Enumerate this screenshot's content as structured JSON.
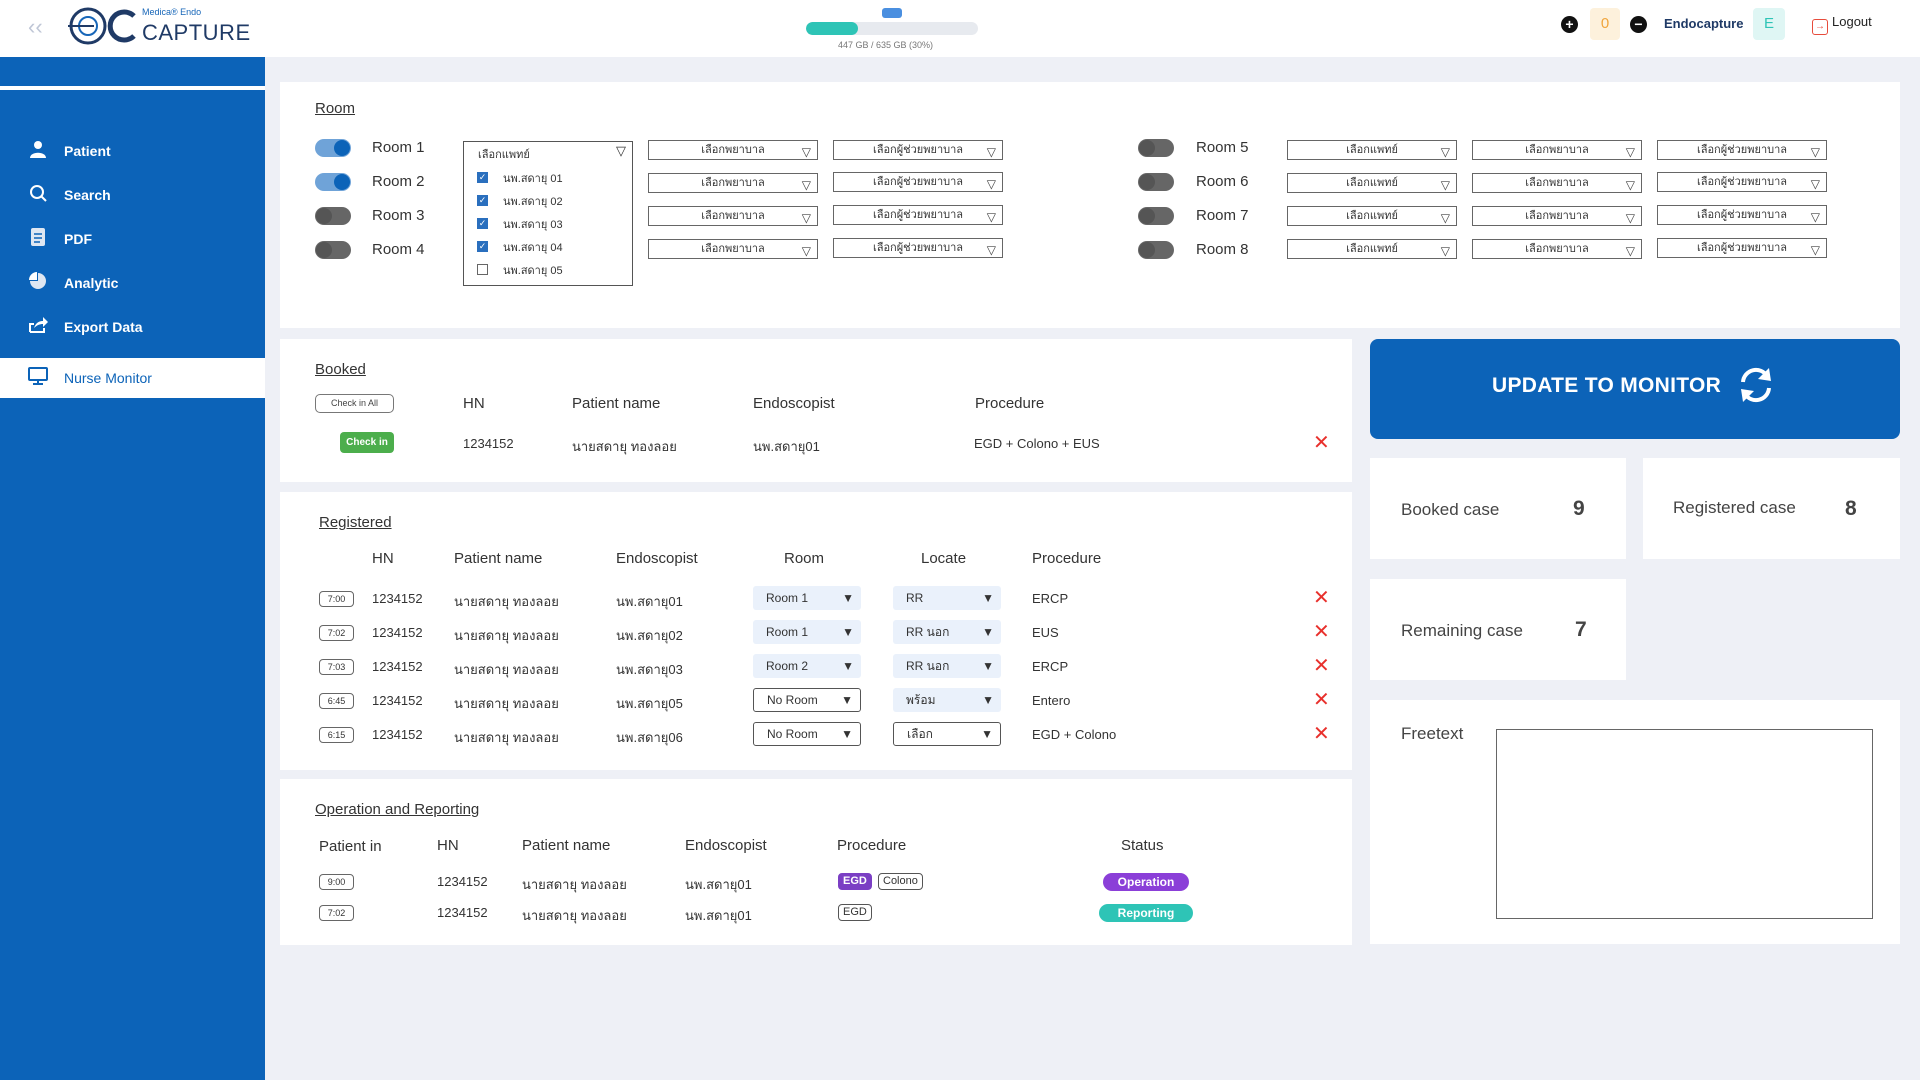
{
  "header": {
    "logo_small": "Medica® Endo",
    "logo_big": "CAPTURE",
    "storage_text": "447 GB / 635 GB    (30%)",
    "storage_percent": 30,
    "counter": "0",
    "user_name": "Endocapture",
    "avatar_letter": "E",
    "logout_label": "Logout"
  },
  "sidebar": {
    "items": [
      {
        "label": "Patient",
        "icon": "person-icon"
      },
      {
        "label": "Search",
        "icon": "search-icon"
      },
      {
        "label": "PDF",
        "icon": "pdf-icon"
      },
      {
        "label": "Analytic",
        "icon": "chart-icon"
      },
      {
        "label": "Export Data",
        "icon": "share-icon"
      },
      {
        "label": "Nurse Monitor",
        "icon": "monitor-icon"
      }
    ]
  },
  "room_section": {
    "title": "Room",
    "rooms": [
      {
        "label": "Room 1",
        "on": true
      },
      {
        "label": "Room 2",
        "on": true
      },
      {
        "label": "Room 3",
        "on": false
      },
      {
        "label": "Room 4",
        "on": false
      },
      {
        "label": "Room 5",
        "on": false
      },
      {
        "label": "Room 6",
        "on": false
      },
      {
        "label": "Room 7",
        "on": false
      },
      {
        "label": "Room 8",
        "on": false
      }
    ],
    "doctor_placeholder": "เลือกแพทย์",
    "nurse_placeholder": "เลือกพยาบาล",
    "assistant_placeholder": "เลือกผู้ช่วยพยาบาล",
    "doctor_options": [
      {
        "label": "นพ.สดายุ 01",
        "checked": true
      },
      {
        "label": "นพ.สดายุ 02",
        "checked": true
      },
      {
        "label": "นพ.สดายุ 03",
        "checked": true
      },
      {
        "label": "นพ.สดายุ 04",
        "checked": true
      },
      {
        "label": "นพ.สดายุ 05",
        "checked": false
      }
    ]
  },
  "booked": {
    "title": "Booked",
    "check_in_all": "Check in All",
    "headers": {
      "hn": "HN",
      "name": "Patient name",
      "endoscopist": "Endoscopist",
      "procedure": "Procedure"
    },
    "row": {
      "action": "Check in",
      "hn": "1234152",
      "name": "นายสดายุ ทองลอย",
      "endoscopist": "นพ.สดายุ01",
      "procedure": "EGD + Colono + EUS"
    }
  },
  "registered": {
    "title": "Registered",
    "headers": {
      "hn": "HN",
      "name": "Patient name",
      "endoscopist": "Endoscopist",
      "room": "Room",
      "locate": "Locate",
      "procedure": "Procedure"
    },
    "rows": [
      {
        "time": "7:00",
        "hn": "1234152",
        "name": "นายสดายุ ทองลอย",
        "endoscopist": "นพ.สดายุ01",
        "room": "Room 1",
        "locate": "RR",
        "procedure": "ERCP"
      },
      {
        "time": "7:02",
        "hn": "1234152",
        "name": "นายสดายุ ทองลอย",
        "endoscopist": "นพ.สดายุ02",
        "room": "Room 1",
        "locate": "RR นอก",
        "procedure": "EUS"
      },
      {
        "time": "7:03",
        "hn": "1234152",
        "name": "นายสดายุ ทองลอย",
        "endoscopist": "นพ.สดายุ03",
        "room": "Room 2",
        "locate": "RR นอก",
        "procedure": "ERCP"
      },
      {
        "time": "6:45",
        "hn": "1234152",
        "name": "นายสดายุ ทองลอย",
        "endoscopist": "นพ.สดายุ05",
        "room": "No Room",
        "locate": "พร้อม",
        "procedure": "Entero"
      },
      {
        "time": "6:15",
        "hn": "1234152",
        "name": "นายสดายุ ทองลอย",
        "endoscopist": "นพ.สดายุ06",
        "room": "No Room",
        "locate": "เลือก",
        "procedure": "EGD + Colono"
      }
    ]
  },
  "operation": {
    "title": "Operation and Reporting",
    "headers": {
      "patient_in": "Patient in",
      "hn": "HN",
      "name": "Patient name",
      "endoscopist": "Endoscopist",
      "procedure": "Procedure",
      "status": "Status"
    },
    "rows": [
      {
        "time": "9:00",
        "hn": "1234152",
        "name": "นายสดายุ ทองลอย",
        "endoscopist": "นพ.สดายุ01",
        "tags": [
          "EGD",
          "Colono"
        ],
        "status": "Operation",
        "status_color": "#8b3fd8"
      },
      {
        "time": "7:02",
        "hn": "1234152",
        "name": "นายสดายุ ทองลอย",
        "endoscopist": "นพ.สดายุ01",
        "tags": [
          "EGD"
        ],
        "status": "Reporting",
        "status_color": "#2ec4b6"
      }
    ]
  },
  "update_button": "UPDATE TO MONITOR",
  "stats": {
    "booked_label": "Booked case",
    "booked_value": "9",
    "registered_label": "Registered case",
    "registered_value": "8",
    "remaining_label": "Remaining case",
    "remaining_value": "7"
  },
  "freetext": {
    "label": "Freetext",
    "value": ""
  },
  "colors": {
    "primary": "#0c63b8",
    "teal": "#2ec4b6",
    "danger": "#e8302c",
    "success": "#4cae4c",
    "purple": "#7b3fc4"
  }
}
